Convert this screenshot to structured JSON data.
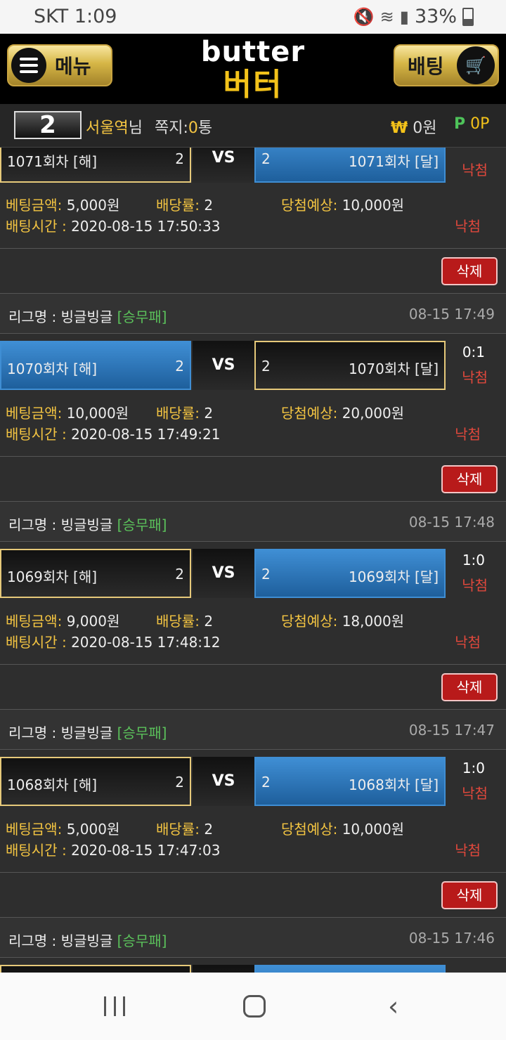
{
  "status_bar": {
    "carrier_time": "SKT 1:09",
    "battery": "33%"
  },
  "header": {
    "menu_label": "메뉴",
    "logo_en": "butter",
    "logo_ko": "버터",
    "bet_label": "배팅"
  },
  "user": {
    "level": "2",
    "name": "서울역",
    "name_suffix": "님",
    "msg_label": "쪽지:",
    "msg_count": "0",
    "msg_unit": "통",
    "won_symbol": "₩",
    "won_value": "0원",
    "point_symbol": "P",
    "point_value": "0P"
  },
  "labels": {
    "league_prefix": "리그명 : ",
    "amount": "베팅금액:",
    "odds": "배당률:",
    "expected": "당첨예상:",
    "bet_time": "배팅시간 : ",
    "vs": "VS",
    "delete": "삭제"
  },
  "bets": [
    {
      "league": "빙글빙글",
      "type": "[승무패]",
      "time": "",
      "home": "1071회차 [해]",
      "home_odds": "2",
      "away": "1071회차 [달]",
      "away_odds": "2",
      "score": "",
      "result": "낙첨",
      "amount": "5,000원",
      "odds": "2",
      "expected": "10,000원",
      "bet_time": "2020-08-15 17:50:33"
    },
    {
      "league": "빙글빙글",
      "type": "[승무패]",
      "time": "08-15 17:49",
      "home": "1070회차 [해]",
      "home_odds": "2",
      "away": "1070회차 [달]",
      "away_odds": "2",
      "score": "0:1",
      "result": "낙첨",
      "amount": "10,000원",
      "odds": "2",
      "expected": "20,000원",
      "bet_time": "2020-08-15 17:49:21"
    },
    {
      "league": "빙글빙글",
      "type": "[승무패]",
      "time": "08-15 17:48",
      "home": "1069회차 [해]",
      "home_odds": "2",
      "away": "1069회차 [달]",
      "away_odds": "2",
      "score": "1:0",
      "result": "낙첨",
      "amount": "9,000원",
      "odds": "2",
      "expected": "18,000원",
      "bet_time": "2020-08-15 17:48:12"
    },
    {
      "league": "빙글빙글",
      "type": "[승무패]",
      "time": "08-15 17:47",
      "home": "1068회차 [해]",
      "home_odds": "2",
      "away": "1068회차 [달]",
      "away_odds": "2",
      "score": "1:0",
      "result": "낙첨",
      "amount": "5,000원",
      "odds": "2",
      "expected": "10,000원",
      "bet_time": "2020-08-15 17:47:03"
    },
    {
      "league": "빙글빙글",
      "type": "[승무패]",
      "time": "08-15 17:46"
    }
  ],
  "colors": {
    "accent_gold": "#f4c542",
    "lose_red": "#e0483c",
    "league_green": "#5bc15b",
    "blue": "#3f8ed4",
    "delete_red": "#b81a1a"
  }
}
